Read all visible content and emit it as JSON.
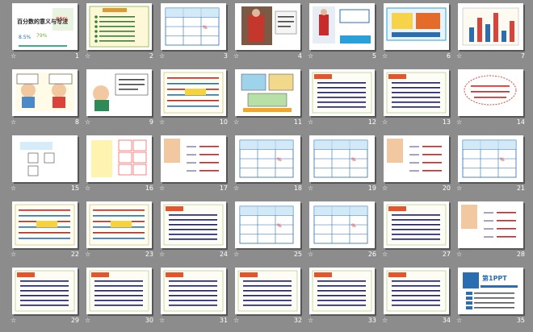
{
  "slides": [
    {
      "num": "1",
      "kind": "title",
      "title": "百分数的意义与写法"
    },
    {
      "num": "2",
      "kind": "list"
    },
    {
      "num": "3",
      "kind": "table"
    },
    {
      "num": "4",
      "kind": "photo"
    },
    {
      "num": "5",
      "kind": "photo2"
    },
    {
      "num": "6",
      "kind": "banner"
    },
    {
      "num": "7",
      "kind": "bars"
    },
    {
      "num": "8",
      "kind": "cartoon"
    },
    {
      "num": "9",
      "kind": "cartoon2"
    },
    {
      "num": "10",
      "kind": "text"
    },
    {
      "num": "11",
      "kind": "diagram"
    },
    {
      "num": "12",
      "kind": "notes"
    },
    {
      "num": "13",
      "kind": "notes"
    },
    {
      "num": "14",
      "kind": "bubble"
    },
    {
      "num": "15",
      "kind": "pencil"
    },
    {
      "num": "16",
      "kind": "grid"
    },
    {
      "num": "17",
      "kind": "fractions"
    },
    {
      "num": "18",
      "kind": "table"
    },
    {
      "num": "19",
      "kind": "table"
    },
    {
      "num": "20",
      "kind": "fractions"
    },
    {
      "num": "21",
      "kind": "table"
    },
    {
      "num": "22",
      "kind": "text"
    },
    {
      "num": "23",
      "kind": "text"
    },
    {
      "num": "24",
      "kind": "notes"
    },
    {
      "num": "25",
      "kind": "table"
    },
    {
      "num": "26",
      "kind": "table"
    },
    {
      "num": "27",
      "kind": "notes"
    },
    {
      "num": "28",
      "kind": "fractions"
    },
    {
      "num": "29",
      "kind": "notes"
    },
    {
      "num": "30",
      "kind": "notes"
    },
    {
      "num": "31",
      "kind": "notes"
    },
    {
      "num": "32",
      "kind": "notes"
    },
    {
      "num": "33",
      "kind": "notes"
    },
    {
      "num": "34",
      "kind": "notes"
    },
    {
      "num": "35",
      "kind": "end",
      "logo": "第1PPT"
    }
  ],
  "star_glyph": "☆"
}
